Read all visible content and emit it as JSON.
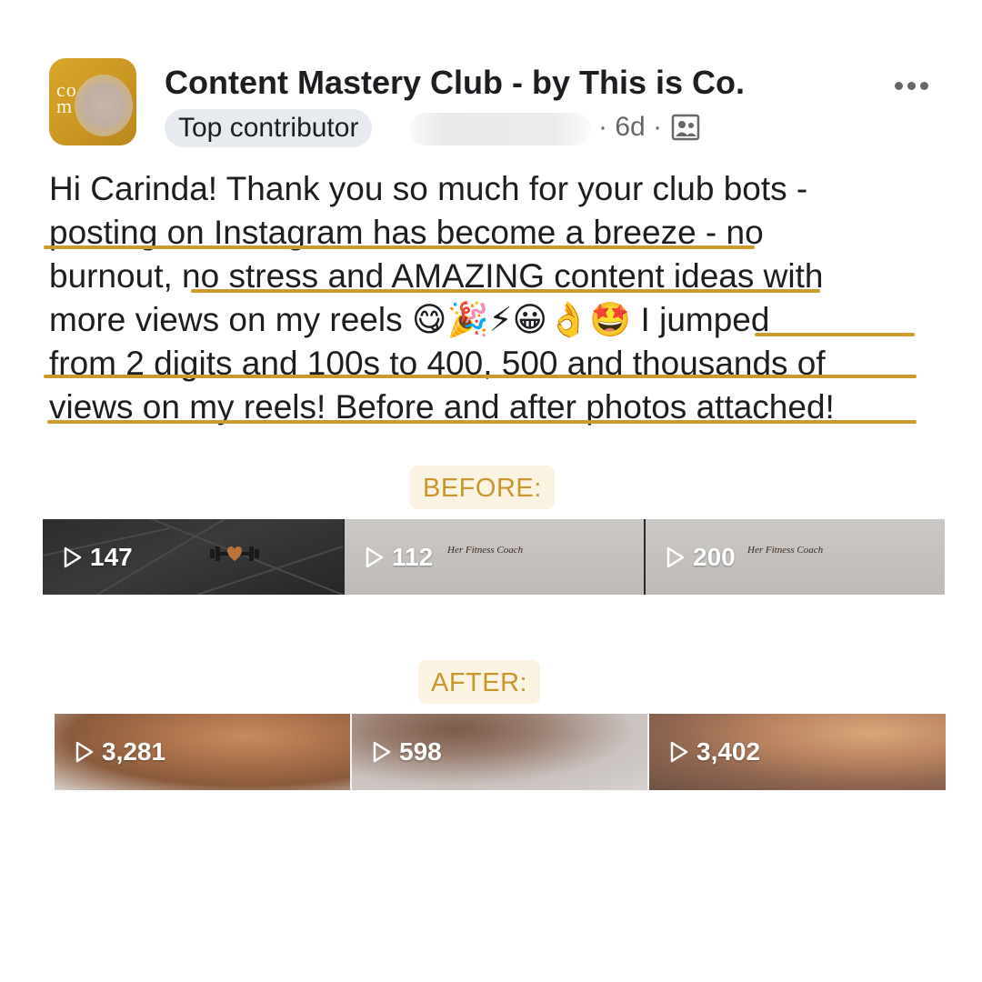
{
  "post": {
    "group_name": "Content Mastery Club - by This is Co.",
    "badge": "Top contributor",
    "time": "6d",
    "separator": "·",
    "avatar_text": "co\nm",
    "icons": {
      "more": "more-dots-icon",
      "audience": "group-audience-icon"
    },
    "text_lines": [
      "Hi Carinda! Thank you so much for your club bots -",
      "posting on Instagram has become a breeze - no",
      "burnout, no stress and AMAZING content ideas with",
      "more views on my reels",
      "I jumped",
      "from 2 digits and 100s to 400, 500 and thousands of",
      "views on my reels! Before and after photos attached!"
    ],
    "emojis": [
      "😋",
      "🎉",
      "⚡",
      "😀",
      "👌",
      "🤩"
    ]
  },
  "before": {
    "label": "BEFORE:",
    "thumbs": [
      {
        "count": "147",
        "caption": ""
      },
      {
        "count": "112",
        "caption": "Her Fitness Coach"
      },
      {
        "count": "200",
        "caption": "Her Fitness Coach"
      }
    ]
  },
  "after": {
    "label": "AFTER:",
    "thumbs": [
      {
        "count": "3,281"
      },
      {
        "count": "598"
      },
      {
        "count": "3,402"
      }
    ]
  },
  "colors": {
    "accent": "#c99a2e",
    "label_bg": "#fbf3e2",
    "meta": "#65676b"
  }
}
